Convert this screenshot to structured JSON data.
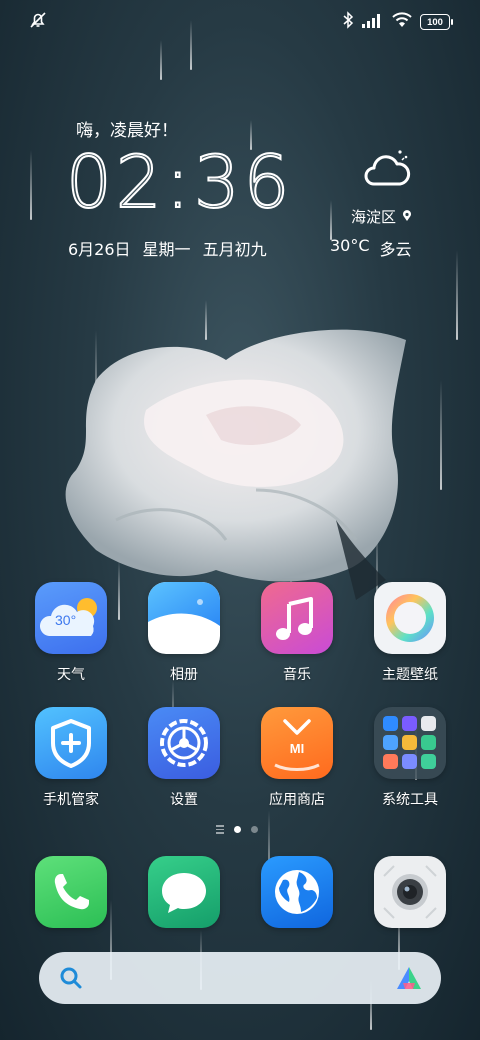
{
  "status_bar": {
    "battery_level": "100",
    "icons": [
      "muted-bell-icon",
      "bluetooth-icon",
      "signal-icon",
      "wifi-icon",
      "battery-icon"
    ]
  },
  "widget": {
    "greeting": "嗨，凌晨好！",
    "time": "02:36",
    "date": "6月26日",
    "weekday": "星期一",
    "lunar_date": "五月初九",
    "location": "海淀区",
    "temperature": "30°C",
    "condition": "多云",
    "weather_icon": "cloudy-night-icon"
  },
  "apps": [
    {
      "label": "天气",
      "icon": "weather-app-icon",
      "badge_text": "30°"
    },
    {
      "label": "相册",
      "icon": "gallery-app-icon"
    },
    {
      "label": "音乐",
      "icon": "music-app-icon"
    },
    {
      "label": "主题壁纸",
      "icon": "themes-app-icon"
    },
    {
      "label": "手机管家",
      "icon": "security-app-icon"
    },
    {
      "label": "设置",
      "icon": "settings-app-icon"
    },
    {
      "label": "应用商店",
      "icon": "app-store-icon",
      "logo_text": "MI"
    },
    {
      "label": "系统工具",
      "icon": "system-tools-folder-icon"
    }
  ],
  "dock": [
    {
      "icon": "phone-icon"
    },
    {
      "icon": "messages-icon"
    },
    {
      "icon": "browser-icon"
    },
    {
      "icon": "camera-icon"
    }
  ],
  "page_indicator": {
    "pages": 2,
    "current": 1
  },
  "search": {
    "icon": "search-icon",
    "assistant_icon": "ai-assistant-icon"
  },
  "colors": {
    "weather_tile": "#4f8cf6",
    "music_tile": "#e55aa8",
    "security_tile": "#3b9af2",
    "settings_tile": "#3b6fe8",
    "store_tile": "#ff7a2e",
    "phone_tile": "#3dd26a",
    "messages_tile": "#21b87d",
    "browser_tile": "#1b7ff0",
    "search_accent": "#1e8bd8"
  }
}
